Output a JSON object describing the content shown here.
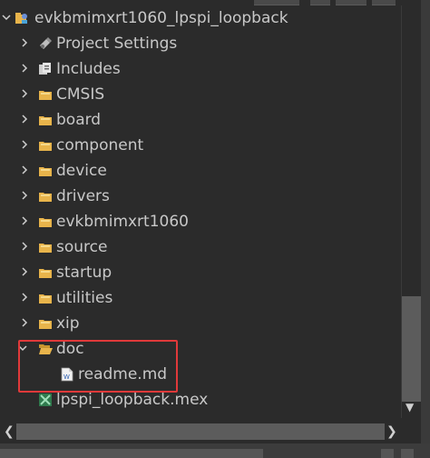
{
  "project": {
    "name": "evkbmimxrt1060_lpspi_loopback",
    "children": [
      {
        "label": "Project Settings",
        "icon": "settings-icon"
      },
      {
        "label": "Includes",
        "icon": "includes-icon"
      },
      {
        "label": "CMSIS",
        "icon": "folder-icon"
      },
      {
        "label": "board",
        "icon": "folder-icon"
      },
      {
        "label": "component",
        "icon": "folder-icon"
      },
      {
        "label": "device",
        "icon": "folder-icon"
      },
      {
        "label": "drivers",
        "icon": "folder-icon"
      },
      {
        "label": "evkbmimxrt1060",
        "icon": "folder-icon"
      },
      {
        "label": "source",
        "icon": "folder-icon"
      },
      {
        "label": "startup",
        "icon": "folder-icon"
      },
      {
        "label": "utilities",
        "icon": "folder-icon"
      },
      {
        "label": "xip",
        "icon": "folder-icon"
      }
    ],
    "doc_folder": {
      "label": "doc",
      "icon": "open-folder-icon",
      "children": [
        {
          "label": "readme.md",
          "icon": "markdown-file-icon"
        }
      ]
    },
    "mex_file": {
      "label": "lpspi_loopback.mex",
      "icon": "mex-file-icon"
    }
  },
  "colors": {
    "background": "#2b2b2b",
    "text": "#c8c8c8",
    "highlight": "#e0393a",
    "folder": "#e8b44b"
  }
}
